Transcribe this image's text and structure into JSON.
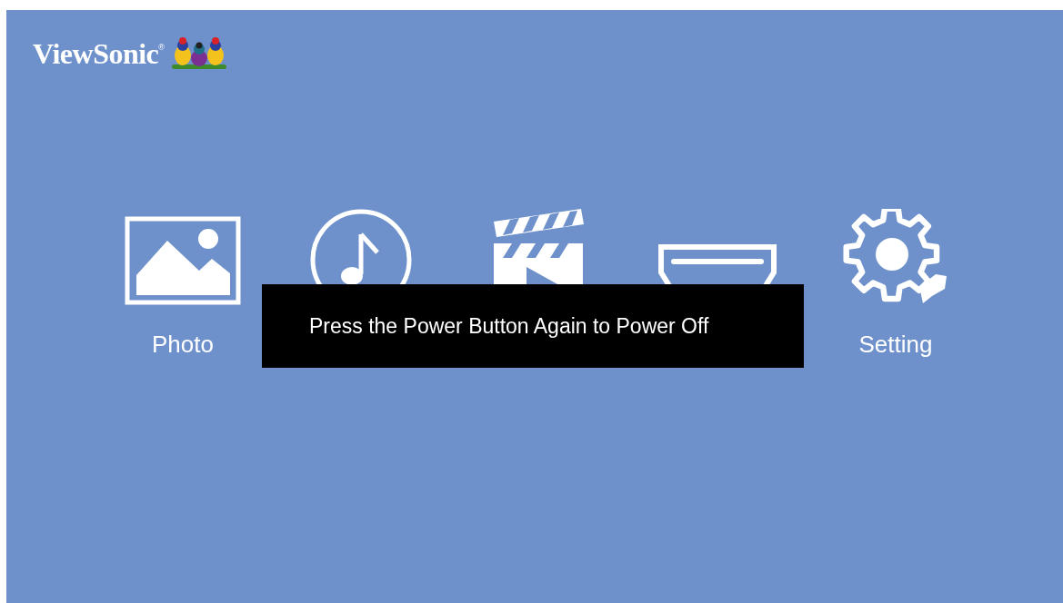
{
  "logo": {
    "brand": "ViewSonic",
    "mark": "®"
  },
  "menu": [
    {
      "kind": "photo",
      "label": "Photo"
    },
    {
      "kind": "music"
    },
    {
      "kind": "video"
    },
    {
      "kind": "input"
    },
    {
      "kind": "setting",
      "label": "Setting"
    }
  ],
  "dialog": {
    "message": "Press the Power Button Again to Power Off"
  }
}
